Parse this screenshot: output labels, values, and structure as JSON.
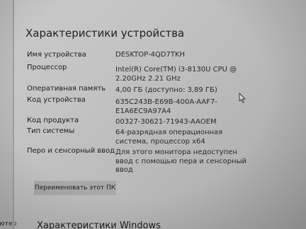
{
  "page": {
    "title": "Характеристики устройства"
  },
  "specs": [
    {
      "label": "Имя устройства",
      "lines": [
        "DESKTOP-4QD7TKH"
      ]
    },
    {
      "label": "Процессор",
      "lines": [
        "Intel(R) Core(TM) i3-8130U CPU @",
        "2.20GHz   2.21 GHz"
      ]
    },
    {
      "label": "Оперативная память",
      "lines": [
        "4,00 ГБ (доступно: 3,89 ГБ)"
      ]
    },
    {
      "label": "Код устройства",
      "lines": [
        "635C243B-E69B-400A-AAF7-",
        "E1A6EC9A97A4"
      ]
    },
    {
      "label": "Код продукта",
      "lines": [
        "00327-30621-71943-AAOEM"
      ]
    },
    {
      "label": "Тип системы",
      "lines": [
        "64-разрядная операционная",
        "система, процессор x64"
      ]
    },
    {
      "label": "Перо и сенсорный ввод",
      "lines": [
        "Для этого монитора недоступен",
        "ввод с помощью пера и сенсорный",
        "ввод"
      ]
    }
  ],
  "buttons": {
    "rename": "Переименовать этот ПК"
  },
  "next_section": {
    "title": "Характеристики Windows"
  },
  "sidebar": {
    "partial_text": "ьютер"
  },
  "icons": {
    "cursor": "mouse-pointer-icon"
  }
}
